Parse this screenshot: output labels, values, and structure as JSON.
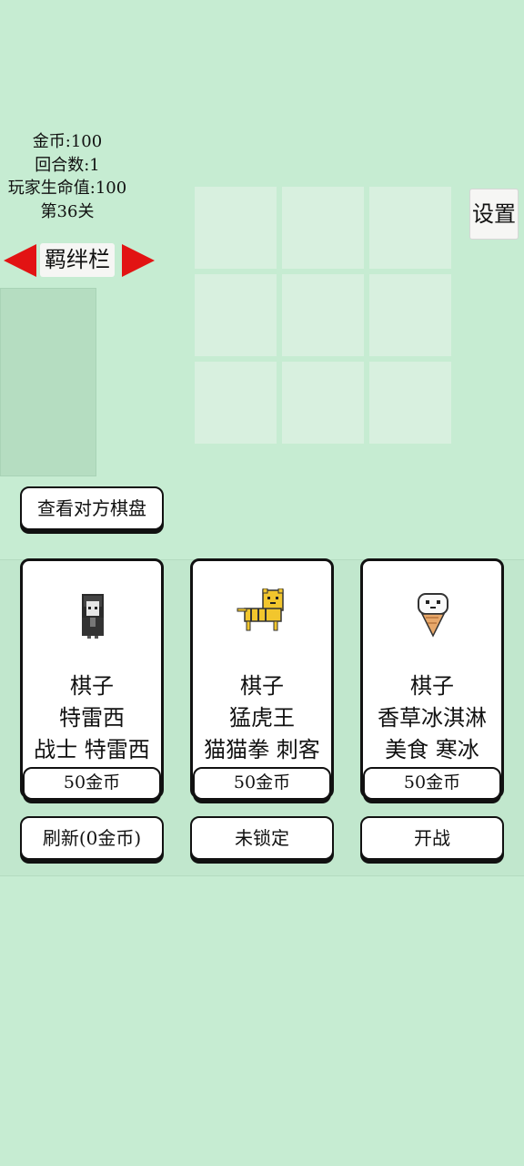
{
  "stats": {
    "gold": "金币:100",
    "round": "回合数:1",
    "player_hp": "玩家生命值:100",
    "level": "第36关"
  },
  "settings_label": "设置",
  "bond": {
    "label": "羁绊栏"
  },
  "view_opponent_label": "查看对方棋盘",
  "shop": {
    "cards": [
      {
        "line1": "棋子",
        "line2": "特雷西",
        "line3": "战士 特雷西",
        "price": "50金币",
        "icon": "hooded-girl-sprite"
      },
      {
        "line1": "棋子",
        "line2": "猛虎王",
        "line3": "猫猫拳 刺客",
        "price": "50金币",
        "icon": "tiger-sprite"
      },
      {
        "line1": "棋子",
        "line2": "香草冰淇淋",
        "line3": "美食 寒冰",
        "price": "50金币",
        "icon": "ice-cream-sprite"
      }
    ],
    "refresh_label": "刷新(0金币)",
    "lock_label": "未锁定",
    "start_label": "开战"
  },
  "colors": {
    "background": "#c6ecd2",
    "arrow": "#e21313",
    "board_cell": "#d8f0df"
  }
}
